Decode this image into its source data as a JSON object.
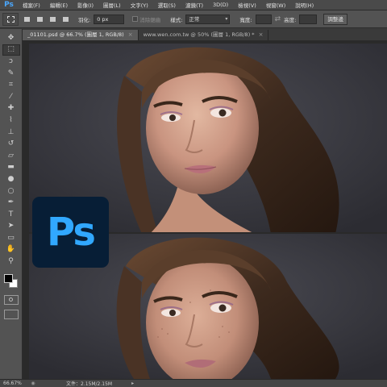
{
  "app": {
    "logo_text": "Ps"
  },
  "menu": [
    "檔案(F)",
    "編輯(E)",
    "影像(I)",
    "圖層(L)",
    "文字(Y)",
    "選取(S)",
    "濾鏡(T)",
    "3D(D)",
    "檢視(V)",
    "視窗(W)",
    "說明(H)"
  ],
  "options": {
    "feather_label": "羽化:",
    "feather_value": "0 px",
    "antialias_label": "消除鋸齒",
    "style_label": "樣式:",
    "style_value": "正常",
    "width_label": "寬度:",
    "height_label": "高度:",
    "refine_label": "調整邊"
  },
  "tabs": [
    {
      "label": "_01101.psd @ 66.7% (圖層 1, RGB/8)",
      "active": true
    },
    {
      "label": "www.wen.com.tw @ 50% (圖層 1, RGB/8) *",
      "active": false
    }
  ],
  "logo": {
    "text": "Ps",
    "bg_color": "#071e36",
    "fg_color": "#31a8ff"
  },
  "status": {
    "zoom": "66.67%",
    "doc_info": "文件：2.15M/2.15M"
  },
  "tools": [
    "move-icon",
    "marquee-icon",
    "lasso-icon",
    "quick-select-icon",
    "crop-icon",
    "eyedropper-icon",
    "healing-icon",
    "brush-icon",
    "stamp-icon",
    "history-brush-icon",
    "eraser-icon",
    "gradient-icon",
    "blur-icon",
    "dodge-icon",
    "pen-icon",
    "type-icon",
    "path-select-icon",
    "shape-icon",
    "hand-icon",
    "zoom-icon"
  ]
}
